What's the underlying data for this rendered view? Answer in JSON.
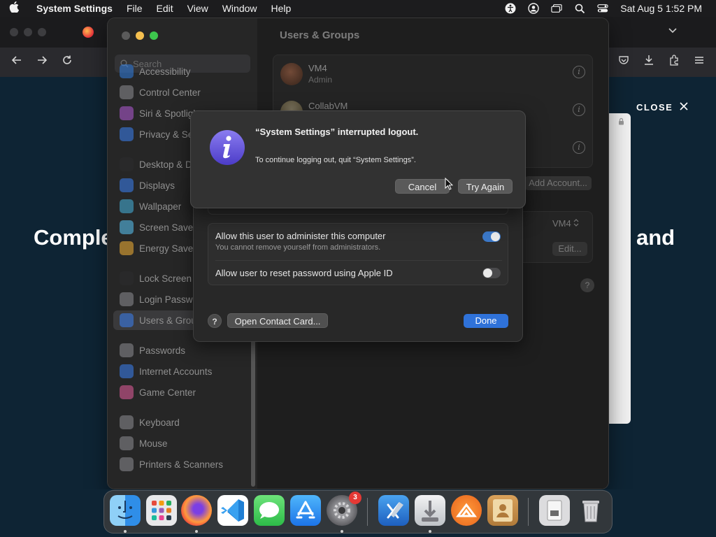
{
  "menubar": {
    "apple_icon": "apple-logo-icon",
    "app_name": "System Settings",
    "menus": [
      "File",
      "Edit",
      "View",
      "Window",
      "Help"
    ],
    "clock": "Sat Aug 5  1:52 PM"
  },
  "browser": {
    "hero_left": "Comple",
    "hero_right": "and",
    "close_label": "CLOSE"
  },
  "settings": {
    "search_placeholder": "Search",
    "sidebar": [
      {
        "label": "Accessibility",
        "color": "#2f7de1",
        "icon": "accessibility-icon"
      },
      {
        "label": "Control Center",
        "color": "#8e8e93",
        "icon": "control-center-icon"
      },
      {
        "label": "Siri & Spotlight",
        "color": "#b45bd8",
        "icon": "siri-icon"
      },
      {
        "label": "Privacy & Security",
        "color": "#3b82f6",
        "icon": "hand-icon"
      },
      {
        "label": "Desktop & Dock",
        "color": "#2c2c2e",
        "icon": "dock-icon"
      },
      {
        "label": "Displays",
        "color": "#3b82f6",
        "icon": "display-icon"
      },
      {
        "label": "Wallpaper",
        "color": "#46b4e0",
        "icon": "wallpaper-icon"
      },
      {
        "label": "Screen Saver",
        "color": "#5ac8fa",
        "icon": "screen-saver-icon"
      },
      {
        "label": "Energy Saver",
        "color": "#f5b335",
        "icon": "battery-icon"
      },
      {
        "label": "Lock Screen",
        "color": "#2c2c2e",
        "icon": "lock-icon"
      },
      {
        "label": "Login Password",
        "color": "#8e8e93",
        "icon": "key-icon"
      },
      {
        "label": "Users & Groups",
        "color": "#3b82f6",
        "icon": "users-icon"
      },
      {
        "label": "Passwords",
        "color": "#8e8e93",
        "icon": "password-key-icon"
      },
      {
        "label": "Internet Accounts",
        "color": "#3b82f6",
        "icon": "at-icon"
      },
      {
        "label": "Game Center",
        "color": "#e85d9e",
        "icon": "game-center-icon"
      },
      {
        "label": "Keyboard",
        "color": "#8e8e93",
        "icon": "keyboard-icon"
      },
      {
        "label": "Mouse",
        "color": "#8e8e93",
        "icon": "mouse-icon"
      },
      {
        "label": "Printers & Scanners",
        "color": "#8e8e93",
        "icon": "printer-icon"
      }
    ],
    "selected_index": 11,
    "pane_title": "Users & Groups",
    "users": [
      {
        "name": "VM4",
        "role": "Admin",
        "avatar_icon": "football-avatar-icon"
      },
      {
        "name": "CollabVM",
        "role": "",
        "avatar_icon": "user-avatar-icon"
      },
      {
        "name": "",
        "role": "",
        "avatar_icon": ""
      }
    ],
    "add_account_label": "Add Account...",
    "autologin_value": "VM4",
    "edit_label": "Edit..."
  },
  "sheet": {
    "admin_label": "Allow this user to administer this computer",
    "admin_sub": "You cannot remove yourself from administrators.",
    "admin_on": true,
    "reset_label": "Allow user to reset password using Apple ID",
    "reset_on": false,
    "help_label": "?",
    "contact_label": "Open Contact Card...",
    "done_label": "Done"
  },
  "alert": {
    "icon": "info-icon",
    "title": "“System Settings” interrupted logout.",
    "message": "To continue logging out, quit “System Settings”.",
    "cancel_label": "Cancel",
    "try_again_label": "Try Again"
  },
  "dock": {
    "apps": [
      {
        "name": "finder-icon",
        "running": true
      },
      {
        "name": "launchpad-icon",
        "running": false
      },
      {
        "name": "firefox-icon",
        "running": true
      },
      {
        "name": "vscode-icon",
        "running": false
      },
      {
        "name": "messages-icon",
        "running": false
      },
      {
        "name": "app-store-icon",
        "running": false
      },
      {
        "name": "system-settings-icon",
        "running": true,
        "badge": "3"
      },
      {
        "name": "xcode-icon",
        "running": false
      },
      {
        "name": "installer-icon",
        "running": true
      },
      {
        "name": "sublime-icon",
        "running": false
      },
      {
        "name": "contacts-icon",
        "running": false
      },
      {
        "name": "downloads-stack-icon",
        "running": false
      },
      {
        "name": "trash-icon",
        "running": false
      }
    ]
  }
}
